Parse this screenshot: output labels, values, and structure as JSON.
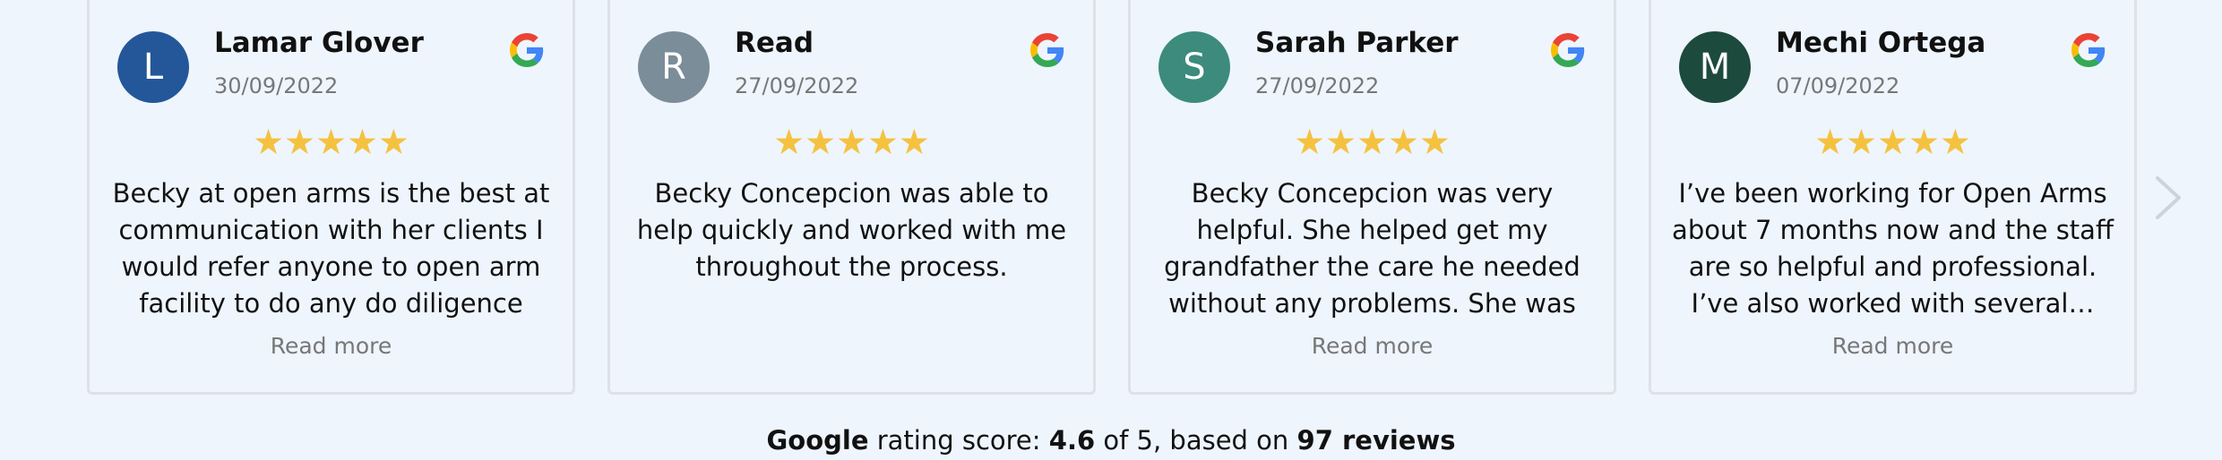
{
  "reviews": [
    {
      "initial": "L",
      "avatar_color": "#23579a",
      "name": "Lamar Glover",
      "date": "30/09/2022",
      "stars": "★★★★★",
      "text": "Becky at open arms is the best at communication with her clients I would refer anyone to open arm facility to do any do diligence love …",
      "read_more": "Read more"
    },
    {
      "initial": "R",
      "avatar_color": "#7c8d9a",
      "name": "Read",
      "date": "27/09/2022",
      "stars": "★★★★★",
      "text": "Becky Concepcion was able to help quickly and worked with me throughout the process.",
      "read_more": ""
    },
    {
      "initial": "S",
      "avatar_color": "#3c8b7c",
      "name": "Sarah Parker",
      "date": "27/09/2022",
      "stars": "★★★★★",
      "text": "Becky Concepcion was very helpful. She helped get my grandfather the care he needed without any problems. She was very helpful wit…",
      "read_more": "Read more"
    },
    {
      "initial": "M",
      "avatar_color": "#1c4a3c",
      "name": "Mechi Ortega",
      "date": "07/09/2022",
      "stars": "★★★★★",
      "text": "I’ve been working for Open Arms about 7 months now and the staff are so helpful and professional. I’ve also worked with several…",
      "read_more": "Read more"
    }
  ],
  "summary": {
    "brand": "Google",
    "label": "rating score:",
    "score": "4.6",
    "of_text": "of 5, based on",
    "reviews_count": "97 reviews"
  },
  "icons": {
    "review_source": "google-icon",
    "next": "chevron-right-icon"
  },
  "colors": {
    "star": "#f4c23f",
    "background": "#eef5fd"
  }
}
